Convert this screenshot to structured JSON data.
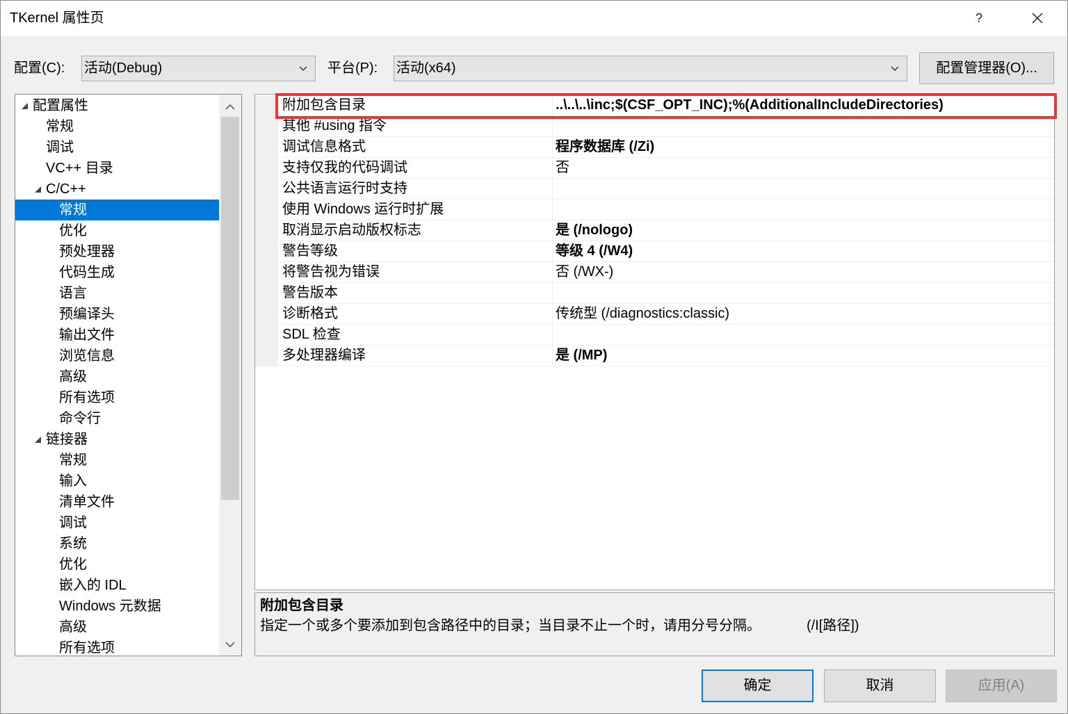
{
  "window": {
    "title": "TKernel 属性页",
    "help_label": "?"
  },
  "toolbar": {
    "config_label": "配置(C):",
    "config_value": "活动(Debug)",
    "platform_label": "平台(P):",
    "platform_value": "活动(x64)",
    "config_manager_label": "配置管理器(O)..."
  },
  "tree": {
    "items": [
      {
        "label": "配置属性"
      },
      {
        "label": "常规"
      },
      {
        "label": "调试"
      },
      {
        "label": "VC++ 目录"
      },
      {
        "label": "C/C++"
      },
      {
        "label": "常规"
      },
      {
        "label": "优化"
      },
      {
        "label": "预处理器"
      },
      {
        "label": "代码生成"
      },
      {
        "label": "语言"
      },
      {
        "label": "预编译头"
      },
      {
        "label": "输出文件"
      },
      {
        "label": "浏览信息"
      },
      {
        "label": "高级"
      },
      {
        "label": "所有选项"
      },
      {
        "label": "命令行"
      },
      {
        "label": "链接器"
      },
      {
        "label": "常规"
      },
      {
        "label": "输入"
      },
      {
        "label": "清单文件"
      },
      {
        "label": "调试"
      },
      {
        "label": "系统"
      },
      {
        "label": "优化"
      },
      {
        "label": "嵌入的 IDL"
      },
      {
        "label": "Windows 元数据"
      },
      {
        "label": "高级"
      },
      {
        "label": "所有选项"
      }
    ]
  },
  "properties": {
    "rows": [
      {
        "name": "附加包含目录",
        "value": "..\\..\\..\\inc;$(CSF_OPT_INC);%(AdditionalIncludeDirectories)"
      },
      {
        "name": "其他 #using 指令",
        "value": ""
      },
      {
        "name": "调试信息格式",
        "value": "程序数据库 (/Zi)"
      },
      {
        "name": "支持仅我的代码调试",
        "value": "否"
      },
      {
        "name": "公共语言运行时支持",
        "value": ""
      },
      {
        "name": "使用 Windows 运行时扩展",
        "value": ""
      },
      {
        "name": "取消显示启动版权标志",
        "value": "是 (/nologo)"
      },
      {
        "name": "警告等级",
        "value": "等级 4 (/W4)"
      },
      {
        "name": "将警告视为错误",
        "value": "否 (/WX-)"
      },
      {
        "name": "警告版本",
        "value": ""
      },
      {
        "name": "诊断格式",
        "value": "传统型 (/diagnostics:classic)"
      },
      {
        "name": "SDL 检查",
        "value": ""
      },
      {
        "name": "多处理器编译",
        "value": "是 (/MP)"
      }
    ]
  },
  "description": {
    "title": "附加包含目录",
    "text": "指定一个或多个要添加到包含路径中的目录；当目录不止一个时，请用分号分隔。",
    "switch": "(/I[路径])"
  },
  "buttons": {
    "ok": "确定",
    "cancel": "取消",
    "apply": "应用(A)"
  },
  "icons": {
    "close": "close-icon",
    "dropdown": "chevron-down-icon",
    "expander": "expanded-triangle-icon",
    "scroll_up": "chevron-up-icon",
    "scroll_down": "chevron-down-icon"
  },
  "colors": {
    "selection_bg": "#0078d7",
    "highlight_box": "#e8373a",
    "default_button_border": "#0078d7",
    "dialog_bg": "#f0f0f0"
  }
}
